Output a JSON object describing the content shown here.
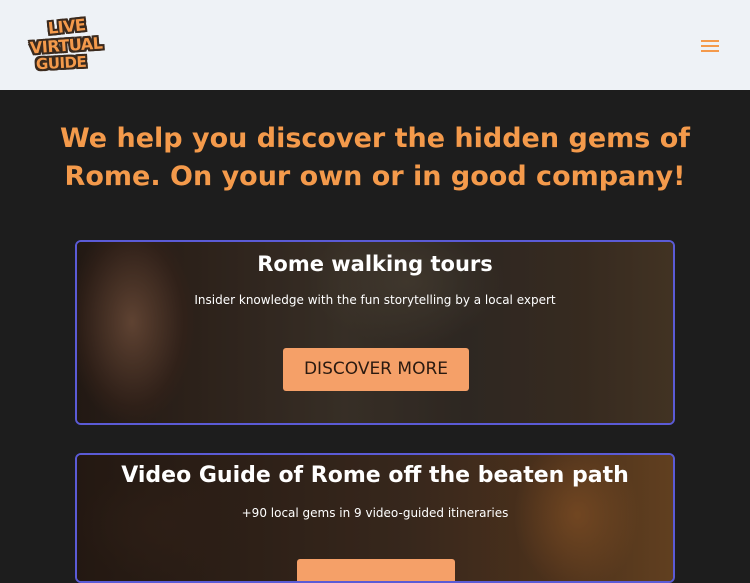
{
  "header": {
    "logo": {
      "word1": "LIVE",
      "word2": "VIRTUAL",
      "word3": "GUIDE"
    },
    "menu_icon": "hamburger-icon"
  },
  "headline": "We help you discover the hidden gems of Rome. On your own or in good company!",
  "cards": [
    {
      "title": "Rome walking tours",
      "subtitle": "Insider knowledge with the fun storytelling by a local expert",
      "button_label": "DISCOVER MORE"
    },
    {
      "title": "Video Guide of Rome off the beaten path",
      "subtitle": "+90 local gems in 9 video-guided itineraries"
    }
  ],
  "colors": {
    "accent": "#f49a4b",
    "header_bg": "#eef2f6",
    "page_bg": "#1d1d1d",
    "card_border": "#5b5bd6",
    "button_bg": "#f5a068"
  }
}
